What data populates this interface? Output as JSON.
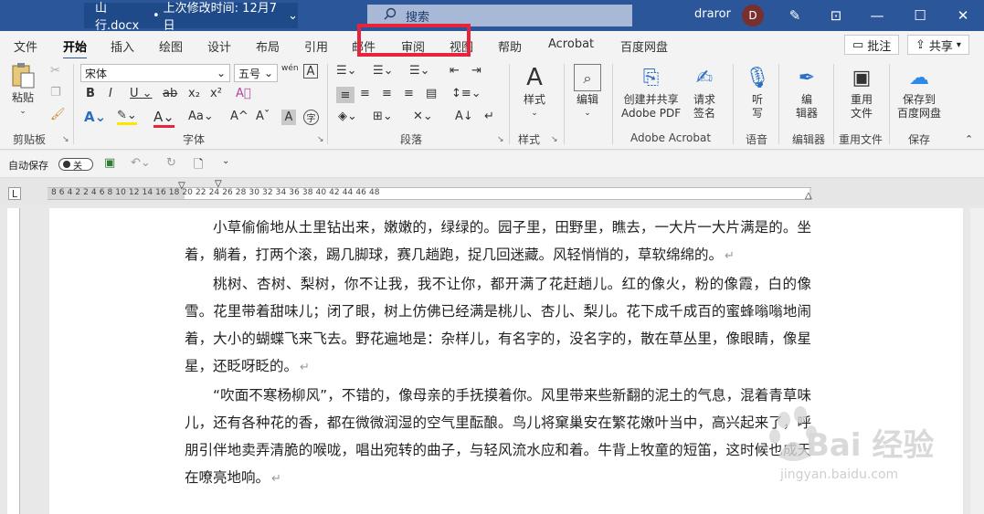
{
  "titlebar": {
    "doc_name": "山行.docx",
    "separator": "•",
    "modified": "上次修改时间: 12月7日",
    "search_placeholder": "搜索",
    "user": "draror",
    "avatar_letter": "D"
  },
  "tabs": [
    {
      "label": "文件",
      "active": false
    },
    {
      "label": "开始",
      "active": true
    },
    {
      "label": "插入",
      "active": false
    },
    {
      "label": "绘图",
      "active": false
    },
    {
      "label": "设计",
      "active": false
    },
    {
      "label": "布局",
      "active": false
    },
    {
      "label": "引用",
      "active": false
    },
    {
      "label": "邮件",
      "active": false
    },
    {
      "label": "审阅",
      "active": false
    },
    {
      "label": "视图",
      "active": false
    },
    {
      "label": "帮助",
      "active": false
    },
    {
      "label": "Acrobat",
      "active": false
    },
    {
      "label": "百度网盘",
      "active": false
    }
  ],
  "menu_right": {
    "comment_label": "批注",
    "share_label": "共享"
  },
  "ribbon": {
    "paste_label": "粘贴",
    "clipboard_label": "剪贴板",
    "font_name": "宋体",
    "font_size": "五号",
    "font_label": "字体",
    "paragraph_label": "段落",
    "style_btn": "样式",
    "styles_label": "样式",
    "edit_btn": "编辑",
    "pdf_btn_line1": "创建并共享",
    "pdf_btn_line2": "Adobe PDF",
    "sign_btn_line1": "请求",
    "sign_btn_line2": "签名",
    "acrobat_label": "Adobe Acrobat",
    "listen_line1": "听",
    "listen_line2": "写",
    "voice_label": "语音",
    "editor_line1": "编",
    "editor_line2": "辑器",
    "editor_label": "编辑器",
    "reuse_line1": "重用",
    "reuse_line2": "文件",
    "reuse_label": "重用文件",
    "baidu_line1": "保存到",
    "baidu_line2": "百度网盘",
    "save_label": "保存"
  },
  "qat": {
    "autosave_label": "自动保存",
    "toggle_label": "关"
  },
  "ruler": {
    "marks": "8  6  4  2     2  4  6  8  10  12  14  16  18  20  22  24  26  28  30  32  34  36  38  40  42  44  46  48"
  },
  "document": {
    "paragraphs": [
      "小草偷偷地从土里钻出来，嫩嫩的，绿绿的。园子里，田野里，瞧去，一大片一大片满是的。坐着，躺着，打两个滚，踢几脚球，赛几趟跑，捉几回迷藏。风轻悄悄的，草软绵绵的。",
      "桃树、杏树、梨树，你不让我，我不让你，都开满了花赶趟儿。红的像火，粉的像霞，白的像雪。花里带着甜味儿；闭了眼，树上仿佛已经满是桃儿、杏儿、梨儿。花下成千成百的蜜蜂嗡嗡地闹着，大小的蝴蝶飞来飞去。野花遍地是：杂样儿，有名字的，没名字的，散在草丛里，像眼睛，像星星，还眨呀眨的。",
      "“吹面不寒杨柳风”，不错的，像母亲的手抚摸着你。风里带来些新翻的泥土的气息，混着青草味儿，还有各种花的香，都在微微润湿的空气里酝酿。鸟儿将窠巢安在繁花嫩叶当中，高兴起来了，呼朋引伴地卖弄清脆的喉咙，唱出宛转的曲子，与轻风流水应和着。牛背上牧童的短笛，这时候也成天在嘹亮地响。"
    ],
    "paragraph_mark": "↵"
  },
  "watermark": {
    "brand": "Bai 经验",
    "url": "jingyan.baidu.com"
  }
}
